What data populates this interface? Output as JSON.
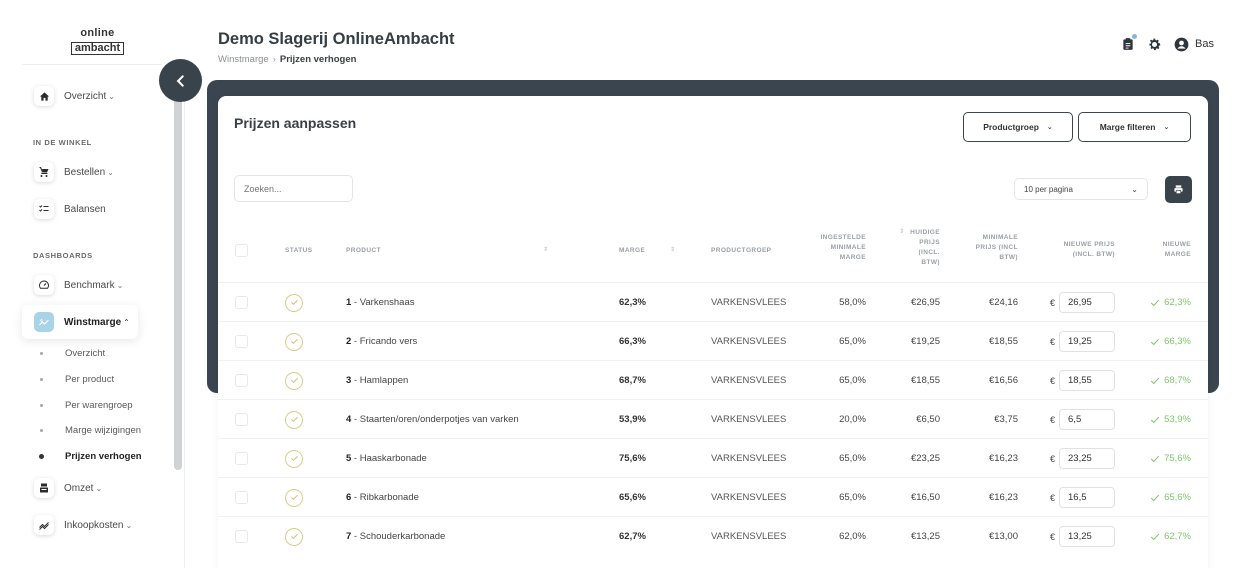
{
  "logo": {
    "top": "online",
    "bottom": "ambacht"
  },
  "header": {
    "title": "Demo Slagerij OnlineAmbacht",
    "breadcrumb": [
      "Winstmarge",
      "Prijzen verhogen"
    ],
    "user": "Bas"
  },
  "sidebar": {
    "overview": {
      "label": "Overzicht",
      "icon": "home-icon"
    },
    "section_shop": "IN DE WINKEL",
    "shop_items": [
      {
        "label": "Bestellen",
        "icon": "cart-icon",
        "has_chevron": true
      },
      {
        "label": "Balansen",
        "icon": "checklist-icon",
        "has_chevron": false
      }
    ],
    "section_dashboards": "DASHBOARDS",
    "dash_items": [
      {
        "label": "Benchmark",
        "icon": "gauge-icon"
      },
      {
        "label": "Winstmarge",
        "icon": "chart-icon",
        "active": true
      }
    ],
    "sub_items": [
      "Overzicht",
      "Per product",
      "Per warengroep",
      "Marge wijzigingen",
      "Prijzen verhogen"
    ],
    "active_sub": "Prijzen verhogen",
    "more_items": [
      {
        "label": "Omzet",
        "icon": "register-icon"
      },
      {
        "label": "Inkoopkosten",
        "icon": "trend-icon"
      }
    ]
  },
  "card": {
    "title": "Prijzen aanpassen",
    "productgroup_button": "Productgroep",
    "marge_button": "Marge filteren",
    "search_placeholder": "Zoeken...",
    "per_page": "10 per pagina"
  },
  "table": {
    "headers": {
      "status": "STATUS",
      "product": "PRODUCT",
      "marge": "MARGE",
      "productgroep": "PRODUCTGROEP",
      "ingestelde": [
        "INGESTELDE",
        "MINIMALE",
        "MARGE"
      ],
      "huidige": [
        "HUIDIGE",
        "PRIJS",
        "(INCL.",
        "BTW)"
      ],
      "minimale": [
        "MINIMALE",
        "PRIJS (INCL",
        "BTW)"
      ],
      "nieuwe_prijs": [
        "NIEUWE PRIJS",
        "(INCL. BTW)"
      ],
      "nieuwe_marge": [
        "NIEUWE",
        "MARGE"
      ]
    },
    "currency": "€",
    "rows": [
      {
        "num": "1",
        "name": "Varkenshaas",
        "marge": "62,3%",
        "group": "VARKENSVLEES",
        "min_marge": "58,0%",
        "current": "€26,95",
        "min_price": "€24,16",
        "new_price": "26,95",
        "new_marge": "62,3%"
      },
      {
        "num": "2",
        "name": "Fricando vers",
        "marge": "66,3%",
        "group": "VARKENSVLEES",
        "min_marge": "65,0%",
        "current": "€19,25",
        "min_price": "€18,55",
        "new_price": "19,25",
        "new_marge": "66,3%"
      },
      {
        "num": "3",
        "name": "Hamlappen",
        "marge": "68,7%",
        "group": "VARKENSVLEES",
        "min_marge": "65,0%",
        "current": "€18,55",
        "min_price": "€16,56",
        "new_price": "18,55",
        "new_marge": "68,7%"
      },
      {
        "num": "4",
        "name": "Staarten/oren/onderpotjes van varken",
        "marge": "53,9%",
        "group": "VARKENSVLEES",
        "min_marge": "20,0%",
        "current": "€6,50",
        "min_price": "€3,75",
        "new_price": "6,5",
        "new_marge": "53,9%"
      },
      {
        "num": "5",
        "name": "Haaskarbonade",
        "marge": "75,6%",
        "group": "VARKENSVLEES",
        "min_marge": "65,0%",
        "current": "€23,25",
        "min_price": "€16,23",
        "new_price": "23,25",
        "new_marge": "75,6%"
      },
      {
        "num": "6",
        "name": "Ribkarbonade",
        "marge": "65,6%",
        "group": "VARKENSVLEES",
        "min_marge": "65,0%",
        "current": "€16,50",
        "min_price": "€16,23",
        "new_price": "16,5",
        "new_marge": "65,6%"
      },
      {
        "num": "7",
        "name": "Schouderkarbonade",
        "marge": "62,7%",
        "group": "VARKENSVLEES",
        "min_marge": "62,0%",
        "current": "€13,25",
        "min_price": "€13,00",
        "new_price": "13,25",
        "new_marge": "62,7%"
      }
    ]
  },
  "colors": {
    "dark": "#3a454f",
    "accent": "#a9d3e6",
    "success": "#7ec66a"
  }
}
